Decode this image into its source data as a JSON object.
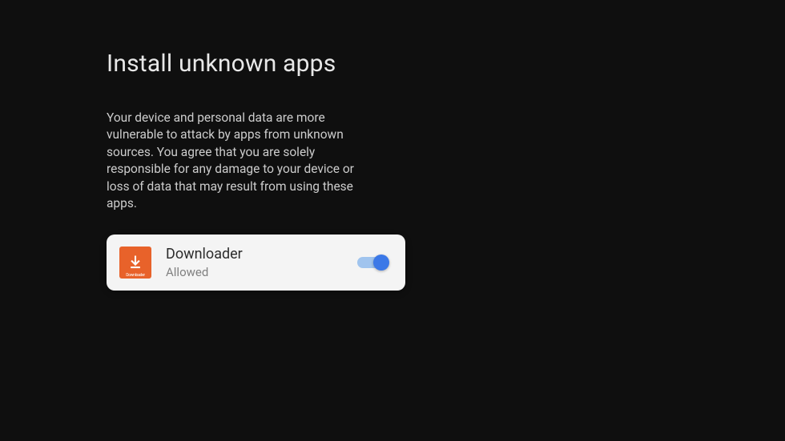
{
  "page": {
    "title": "Install unknown apps",
    "description": "Your device and personal data are more vulnerable to attack by apps from unknown sources. You agree that you are solely responsible for any damage to your device or loss of data that may result from using these apps."
  },
  "apps": [
    {
      "name": "Downloader",
      "status": "Allowed",
      "icon_label": "Downloader",
      "icon_color": "#e8622a",
      "toggle_on": true
    }
  ]
}
